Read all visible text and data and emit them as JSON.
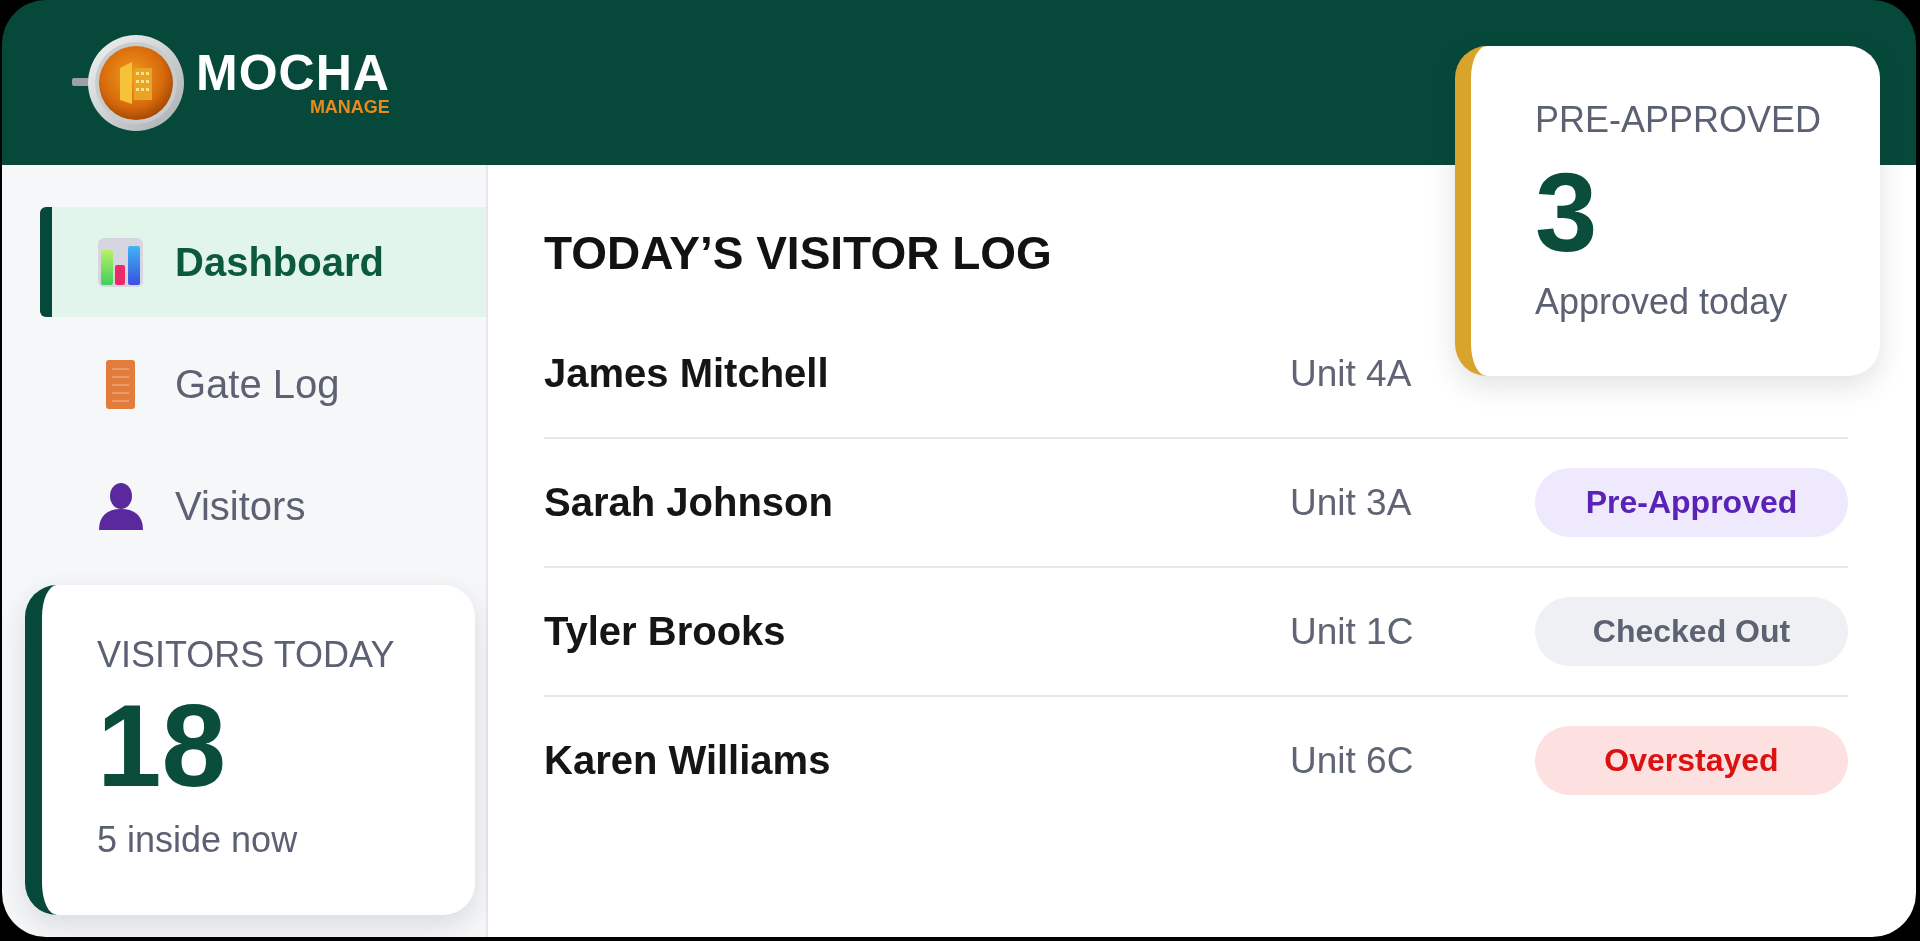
{
  "header": {
    "logo": {
      "title": "MOCHA",
      "subtitle": "MANAGE"
    }
  },
  "sidebar": {
    "items": [
      {
        "label": "Dashboard",
        "selected": true
      },
      {
        "label": "Gate Log",
        "selected": false
      },
      {
        "label": "Visitors",
        "selected": false
      }
    ],
    "stat_card": {
      "title": "VISITORS TODAY",
      "value": "18",
      "caption": "5 inside now"
    }
  },
  "visitor_log": {
    "title": "TODAY’S VISITOR LOG",
    "rows": [
      {
        "name": "James Mitchell",
        "unit": "Unit 4A"
      },
      {
        "name": "Sarah Johnson",
        "unit": "Unit 3A",
        "status": {
          "label": "Pre-Approved",
          "kind": "pre_approved"
        }
      },
      {
        "name": "Tyler Brooks",
        "unit": "Unit 1C",
        "status": {
          "label": "Checked Out",
          "kind": "checked_out"
        }
      },
      {
        "name": "Karen Williams",
        "unit": "Unit 6C",
        "status": {
          "label": "Overstayed",
          "kind": "overstayed"
        }
      }
    ]
  },
  "pre_approved_card": {
    "title": "PRE-APPROVED",
    "value": "3",
    "caption": "Approved today"
  }
}
